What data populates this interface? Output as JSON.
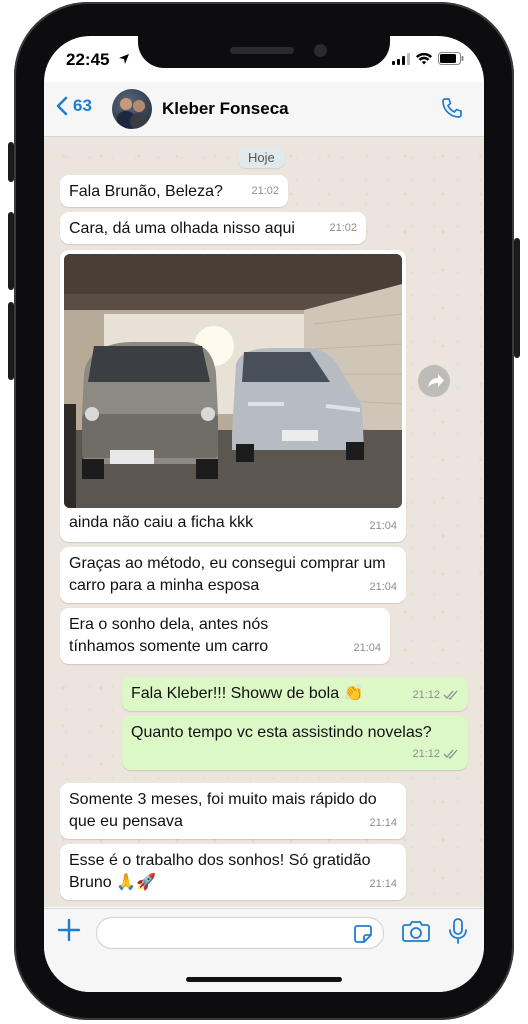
{
  "status_bar": {
    "time": "22:45"
  },
  "header": {
    "back_count": "63",
    "contact_name": "Kleber Fonseca"
  },
  "date_pill": "Hoje",
  "messages": [
    {
      "dir": "in",
      "text": "Fala Brunão, Beleza?",
      "time": "21:02"
    },
    {
      "dir": "in",
      "text": "Cara, dá uma olhada nisso aqui",
      "time": "21:02"
    },
    {
      "dir": "in",
      "text": "ainda não caiu a ficha kkk",
      "time": "21:04",
      "has_photo": true
    },
    {
      "dir": "in",
      "text": "Graças ao método, eu consegui comprar um carro para a minha esposa",
      "time": "21:04"
    },
    {
      "dir": "in",
      "text": "Era o sonho dela, antes nós tínhamos somente um carro",
      "time": "21:04"
    },
    {
      "dir": "out",
      "text": "Fala Kleber!!! Showw de bola 👏",
      "time": "21:12",
      "read": true
    },
    {
      "dir": "out",
      "text": "Quanto tempo vc esta assistindo novelas?",
      "time": "21:12",
      "read": true
    },
    {
      "dir": "in",
      "text": "Somente 3 meses, foi muito mais rápido do que eu pensava",
      "time": "21:14"
    },
    {
      "dir": "in",
      "text": "Esse é o trabalho dos sonhos! Só gratidão Bruno 🙏🚀",
      "time": "21:14"
    }
  ],
  "colors": {
    "accent": "#1e7dd0",
    "incoming": "#ffffff",
    "outgoing": "#dcf8c6",
    "chat_bg": "#ece5dd"
  },
  "icons": [
    "location-arrow-icon",
    "signal-icon",
    "wifi-icon",
    "battery-icon",
    "back-chevron-icon",
    "phone-icon",
    "forward-icon",
    "plus-icon",
    "sticker-icon",
    "camera-icon",
    "mic-icon",
    "double-check-icon"
  ]
}
